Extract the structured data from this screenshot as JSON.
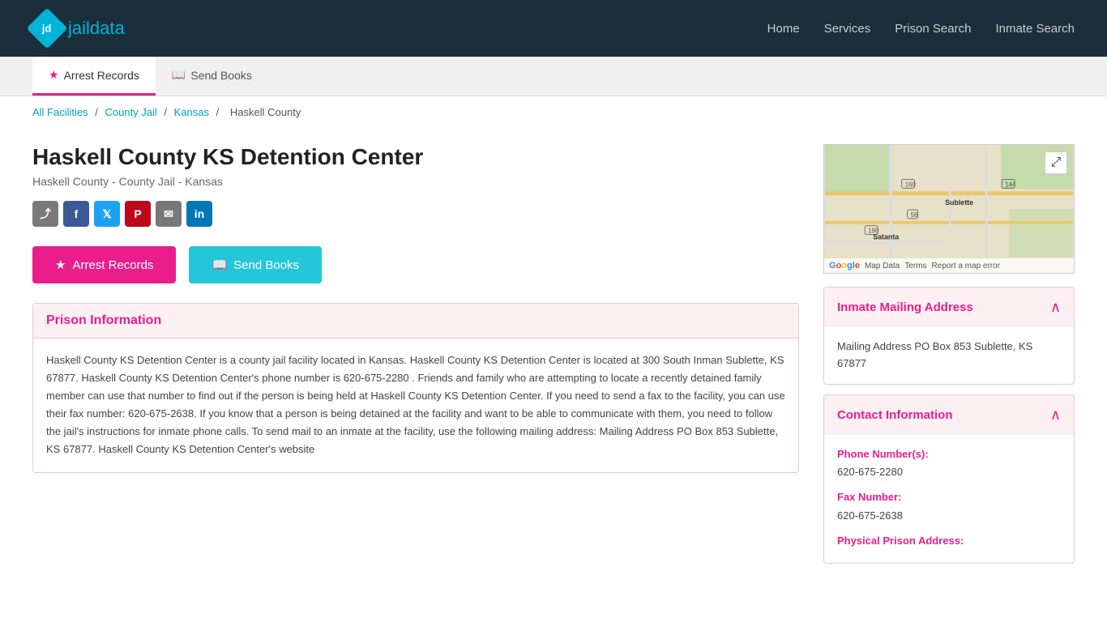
{
  "header": {
    "logo_text_jd": "jd",
    "logo_text_jail": "jail",
    "logo_text_data": "data",
    "nav": [
      {
        "label": "Home",
        "href": "#"
      },
      {
        "label": "Services",
        "href": "#"
      },
      {
        "label": "Prison Search",
        "href": "#"
      },
      {
        "label": "Inmate Search",
        "href": "#"
      }
    ]
  },
  "subnav": {
    "items": [
      {
        "label": "Arrest Records",
        "active": true
      },
      {
        "label": "Send Books",
        "active": false
      }
    ]
  },
  "breadcrumb": {
    "items": [
      {
        "label": "All Facilities",
        "link": true
      },
      {
        "label": "County Jail",
        "link": true
      },
      {
        "label": "Kansas",
        "link": true
      },
      {
        "label": "Haskell County",
        "link": false
      }
    ],
    "separator": "/"
  },
  "page": {
    "title": "Haskell County KS Detention Center",
    "subtitle": "Haskell County - County Jail - Kansas",
    "arrest_records_btn": "Arrest Records",
    "send_books_btn": "Send Books",
    "prison_info_heading": "Prison Information",
    "prison_info_body": "Haskell County KS Detention Center is a county jail facility located in Kansas. Haskell County KS Detention Center is located at 300 South Inman Sublette, KS 67877. Haskell County KS Detention Center's phone number is 620-675-2280 . Friends and family who are attempting to locate a recently detained family member can use that number to find out if the person is being held at Haskell County KS Detention Center. If you need to send a fax to the facility, you can use their fax number: 620-675-2638. If you know that a person is being detained at the facility and want to be able to communicate with them, you need to follow the jail's instructions for inmate phone calls. To send mail to an inmate at the facility, use the following mailing address: Mailing Address PO Box 853 Sublette, KS 67877. Haskell County KS Detention Center's website"
  },
  "right_panel": {
    "map_expand_tooltip": "expand map",
    "map_bottom": {
      "google_label": "Google",
      "map_data": "Map Data",
      "terms": "Terms",
      "report": "Report a map error"
    },
    "mailing_address": {
      "heading": "Inmate Mailing Address",
      "address": "Mailing Address PO Box 853 Sublette, KS 67877"
    },
    "contact_info": {
      "heading": "Contact Information",
      "phone_label": "Phone Number(s):",
      "phone": "620-675-2280",
      "fax_label": "Fax Number:",
      "fax": "620-675-2638",
      "physical_label": "Physical Prison Address:"
    }
  }
}
